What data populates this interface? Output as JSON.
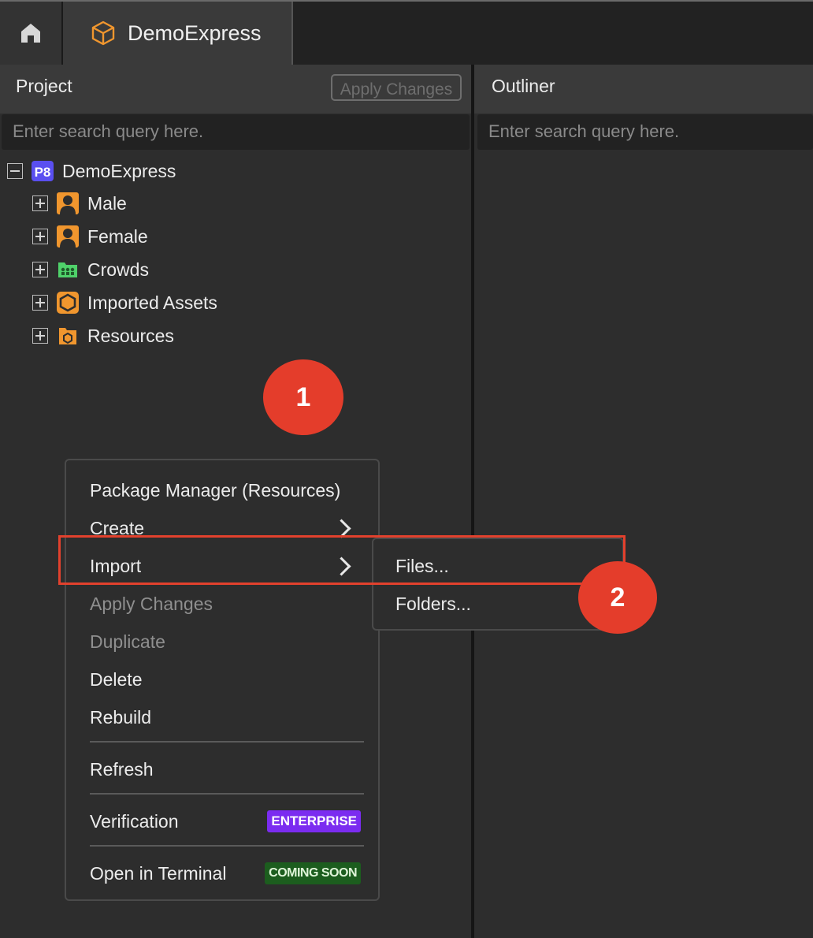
{
  "tabs": {
    "home": {
      "icon": "home-icon"
    },
    "project": {
      "label": "DemoExpress",
      "icon": "cube-icon"
    }
  },
  "project_panel": {
    "title": "Project",
    "apply_changes_label": "Apply Changes",
    "search_placeholder": "Enter search query here."
  },
  "outliner_panel": {
    "title": "Outliner",
    "search_placeholder": "Enter search query here."
  },
  "tree": {
    "root": {
      "label": "DemoExpress",
      "badge": "P8",
      "expanded": true
    },
    "children": [
      {
        "label": "Male",
        "icon": "person-icon"
      },
      {
        "label": "Female",
        "icon": "person-icon"
      },
      {
        "label": "Crowds",
        "icon": "crowd-folder-icon"
      },
      {
        "label": "Imported Assets",
        "icon": "hexagon-icon"
      },
      {
        "label": "Resources",
        "icon": "resource-folder-icon"
      }
    ]
  },
  "steps": [
    "1",
    "2"
  ],
  "context_menu": {
    "items": [
      {
        "label": "Package Manager (Resources)",
        "disabled": false
      },
      {
        "label": "Create",
        "submenu": true
      },
      {
        "label": "Import",
        "submenu": true
      },
      {
        "label": "Apply Changes",
        "disabled": true
      },
      {
        "label": "Duplicate",
        "disabled": true
      },
      {
        "label": "Delete",
        "disabled": false
      },
      {
        "label": "Rebuild",
        "disabled": false
      },
      {
        "label": "Refresh",
        "disabled": false
      },
      {
        "label": "Verification",
        "tag": "ENTERPRISE"
      },
      {
        "label": "Open in Terminal",
        "tag": "COMING SOON"
      }
    ]
  },
  "import_submenu": {
    "items": [
      {
        "label": "Files..."
      },
      {
        "label": "Folders..."
      }
    ]
  },
  "colors": {
    "accent_red": "#e43d2b",
    "enterprise": "#7b2cf0",
    "coming_soon": "#1c5d1e",
    "icon_orange": "#f0962e",
    "p8_blue": "#5a4ff0"
  }
}
